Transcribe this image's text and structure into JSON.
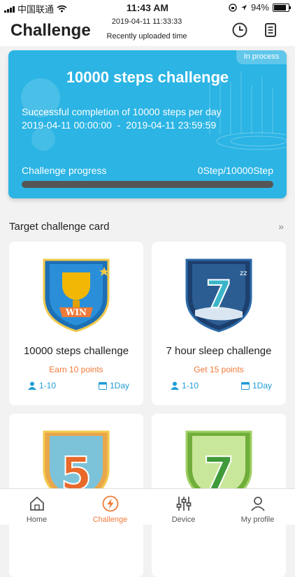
{
  "status_bar": {
    "carrier": "中国联通",
    "time": "11:43 AM",
    "battery": "94%",
    "battery_level": 0.94
  },
  "header": {
    "title": "Challenge",
    "upload_time": "2019-04-11 11:33:33",
    "upload_label": "Recently uploaded time",
    "icons": [
      "clock-icon",
      "list-icon"
    ]
  },
  "hero": {
    "status": "In process",
    "title": "10000 steps challenge",
    "description": "Successful completion of 10000 steps per day",
    "range": "2019-04-11 00:00:00  -  2019-04-11 23:59:59",
    "progress_label": "Challenge progress",
    "progress_value": "0Step/10000Step",
    "progress_fraction": 0
  },
  "section": {
    "title": "Target challenge card",
    "more": "»"
  },
  "cards": [
    {
      "title": "10000 steps challenge",
      "points": "Earn 10 points",
      "people": "1-10",
      "days": "1Day",
      "badge_text": "WIN"
    },
    {
      "title": "7 hour sleep challenge",
      "points": "Get 15 points",
      "people": "1-10",
      "days": "1Day",
      "badge_text": "7"
    },
    {
      "badge_text": "5"
    },
    {
      "badge_text": "7"
    }
  ],
  "tabs": [
    {
      "label": "Home",
      "icon": "home-icon"
    },
    {
      "label": "Challenge",
      "icon": "lightning-icon",
      "active": true
    },
    {
      "label": "Device",
      "icon": "sliders-icon"
    },
    {
      "label": "My profile",
      "icon": "profile-icon"
    }
  ],
  "colors": {
    "accent": "#f07a3a",
    "hero": "#2bb4e4",
    "link": "#1f9bd6"
  }
}
